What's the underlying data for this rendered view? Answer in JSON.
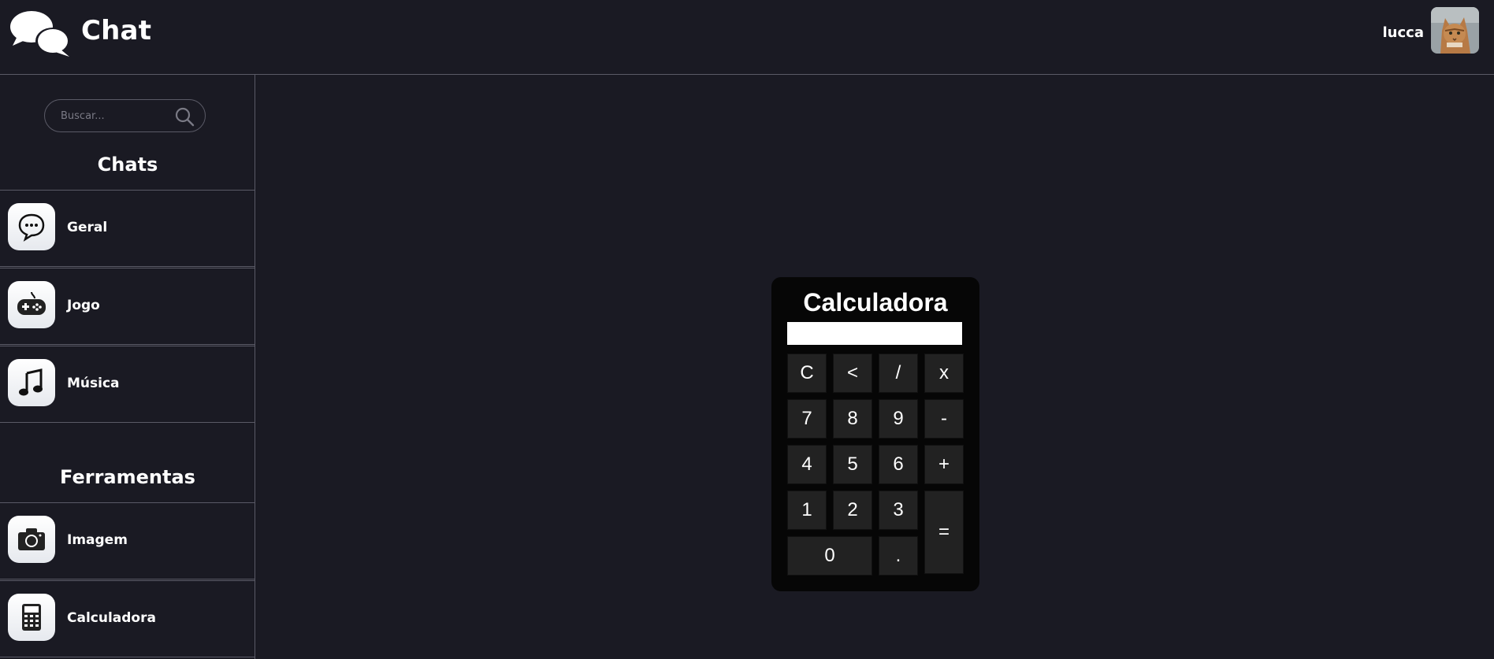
{
  "header": {
    "app_title": "Chat",
    "logo_icon": "chat-bubbles-icon",
    "username": "lucca",
    "avatar_icon": "cat-avatar"
  },
  "sidebar": {
    "search": {
      "placeholder": "Buscar...",
      "value": "",
      "icon": "search-icon"
    },
    "chats_title": "Chats",
    "chats": [
      {
        "label": "Geral",
        "icon": "chat-bubble-icon"
      },
      {
        "label": "Jogo",
        "icon": "gamepad-icon"
      },
      {
        "label": "Música",
        "icon": "music-note-icon"
      }
    ],
    "tools_title": "Ferramentas",
    "tools": [
      {
        "label": "Imagem",
        "icon": "camera-icon"
      },
      {
        "label": "Calculadora",
        "icon": "calculator-icon"
      }
    ]
  },
  "calculator": {
    "title": "Calculadora",
    "display_value": "",
    "keys": {
      "clear": "C",
      "back": "<",
      "divide": "/",
      "multiply": "x",
      "k7": "7",
      "k8": "8",
      "k9": "9",
      "minus": "-",
      "k4": "4",
      "k5": "5",
      "k6": "6",
      "plus": "+",
      "k1": "1",
      "k2": "2",
      "k3": "3",
      "equals": "=",
      "k0": "0",
      "dot": "."
    }
  },
  "colors": {
    "background": "#1a1a23",
    "divider": "#5a5a66",
    "calculator_body": "#060606",
    "key": "#222222",
    "text": "#ffffff"
  }
}
